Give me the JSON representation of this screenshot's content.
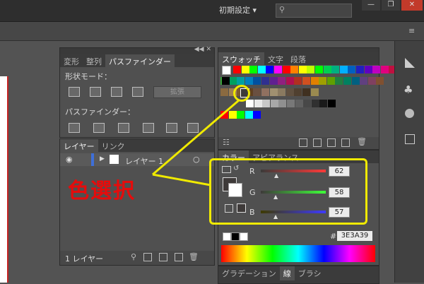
{
  "topbar": {
    "workspace": "初期設定"
  },
  "pathfinder": {
    "tabs": [
      "変形",
      "整列",
      "パスファインダー"
    ],
    "shape_modes_label": "形状モード：",
    "expand_label": "拡張",
    "pathfinders_label": "パスファインダー："
  },
  "layers": {
    "tabs": [
      "レイヤー",
      "リンク"
    ],
    "layer_name": "レイヤー 1",
    "footer": "1 レイヤー"
  },
  "swatches": {
    "tabs": [
      "スウォッチ",
      "文字",
      "段落"
    ],
    "row1": [
      "#ff0000",
      "#ffff00",
      "#00ff00",
      "#00ffff",
      "#0000ff",
      "#ff00ff",
      "#ff0000",
      "#ff8000",
      "#ffff00",
      "#c0ff00",
      "#00ff00",
      "#00d050",
      "#00b080",
      "#00b0ff",
      "#0060c0",
      "#2020c0",
      "#6000c0",
      "#c000c0",
      "#e0007f",
      "#c01040",
      "#ffcc00",
      "#ffe000"
    ],
    "row2": [
      "#3aa43a",
      "#00a060",
      "#00a0a0",
      "#0080c0",
      "#0050a0",
      "#303090",
      "#602090",
      "#902080",
      "#b01050",
      "#b03020",
      "#d05020",
      "#e08000",
      "#a0a000",
      "#60a000",
      "#208040",
      "#008060",
      "#006080",
      "#604080",
      "#804060",
      "#805030"
    ],
    "row3": [
      "#8a6a40",
      "#a08050",
      "#7a5a30",
      "#604020",
      "#6a5040",
      "#907060",
      "#a09070",
      "#8a7a60",
      "#605040",
      "#504030",
      "#403020",
      "#9a8a50"
    ],
    "gray_row": [
      "#ffffff",
      "#e8e8e8",
      "#c8c8c8",
      "#a8a8a8",
      "#909090",
      "#787878",
      "#606060",
      "#484848",
      "#303030",
      "#1a1a1a",
      "#000000"
    ],
    "last_row": [
      "#ff0000",
      "#ffff00",
      "#00ff00",
      "#00ffff",
      "#0000ff"
    ]
  },
  "color": {
    "tabs": [
      "カラー",
      "アピアランス"
    ],
    "channels": [
      {
        "label": "R",
        "value": "62",
        "fraction": 0.243
      },
      {
        "label": "G",
        "value": "58",
        "fraction": 0.227
      },
      {
        "label": "B",
        "value": "57",
        "fraction": 0.224
      }
    ],
    "hex_symbol": "#",
    "hex": "3E3A39"
  },
  "bottom_tabs": [
    "グラデーション",
    "線",
    "ブラシ"
  ],
  "annotation": {
    "text": "色選択",
    "color": "#e50c0c",
    "highlight": "#f0ea00"
  }
}
